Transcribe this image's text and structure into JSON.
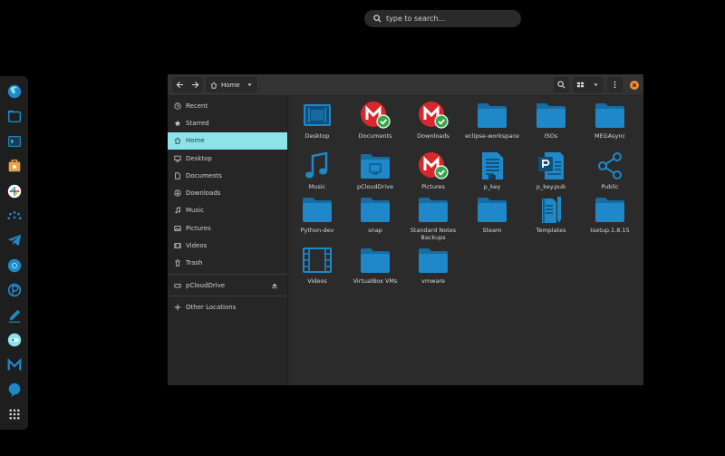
{
  "search": {
    "placeholder": "type to search..."
  },
  "colors": {
    "folder": "#1e88c8",
    "folder_dark": "#156da3",
    "accent": "#8de3ea",
    "mega_red": "#d9272e",
    "check_green": "#3aa54a",
    "close": "#f08a3a"
  },
  "dock": {
    "items": [
      {
        "icon": "firefox-icon"
      },
      {
        "icon": "files-icon"
      },
      {
        "icon": "terminal-icon"
      },
      {
        "icon": "appcenter-icon"
      },
      {
        "icon": "slack-icon"
      },
      {
        "icon": "dots-arc-icon"
      },
      {
        "icon": "telegram-icon"
      },
      {
        "icon": "chromium-icon"
      },
      {
        "icon": "pcloud-icon"
      },
      {
        "icon": "text-editor-icon"
      },
      {
        "icon": "settings-icon"
      },
      {
        "icon": "mega-icon"
      },
      {
        "icon": "chat-icon"
      },
      {
        "icon": "apps-grid-icon"
      }
    ]
  },
  "window": {
    "path": {
      "label": "Home"
    },
    "sidebar": {
      "items": [
        {
          "label": "Recent",
          "icon": "clock-icon"
        },
        {
          "label": "Starred",
          "icon": "star-icon"
        },
        {
          "label": "Home",
          "icon": "home-icon",
          "active": true
        },
        {
          "label": "Desktop",
          "icon": "desktop-icon"
        },
        {
          "label": "Documents",
          "icon": "document-icon"
        },
        {
          "label": "Downloads",
          "icon": "download-icon"
        },
        {
          "label": "Music",
          "icon": "music-icon"
        },
        {
          "label": "Pictures",
          "icon": "picture-icon"
        },
        {
          "label": "Videos",
          "icon": "video-icon"
        },
        {
          "label": "Trash",
          "icon": "trash-icon"
        },
        {
          "label": "pCloudDrive",
          "icon": "drive-icon"
        },
        {
          "label": "Other Locations",
          "icon": "plus-icon"
        }
      ]
    },
    "files": [
      {
        "name": "Desktop",
        "icon": "folder-desktop"
      },
      {
        "name": "Documents",
        "icon": "mega-sync"
      },
      {
        "name": "Downloads",
        "icon": "mega-sync"
      },
      {
        "name": "eclipse-workspace",
        "icon": "folder"
      },
      {
        "name": "ISOs",
        "icon": "folder"
      },
      {
        "name": "MEGAsync",
        "icon": "folder"
      },
      {
        "name": "Music",
        "icon": "music-note"
      },
      {
        "name": "pCloudDrive",
        "icon": "folder-remote"
      },
      {
        "name": "Pictures",
        "icon": "mega-sync"
      },
      {
        "name": "p_key",
        "icon": "text-file"
      },
      {
        "name": "p_key.pub",
        "icon": "pub-file"
      },
      {
        "name": "Public",
        "icon": "share"
      },
      {
        "name": "Python-dev",
        "icon": "folder"
      },
      {
        "name": "snap",
        "icon": "folder"
      },
      {
        "name": "Standard Notes Backups",
        "icon": "folder"
      },
      {
        "name": "Steam",
        "icon": "folder"
      },
      {
        "name": "Templates",
        "icon": "templates"
      },
      {
        "name": "tsetup.1.8.15",
        "icon": "folder"
      },
      {
        "name": "Videos",
        "icon": "film"
      },
      {
        "name": "VirtualBox VMs",
        "icon": "folder"
      },
      {
        "name": "vmware",
        "icon": "folder"
      }
    ]
  }
}
